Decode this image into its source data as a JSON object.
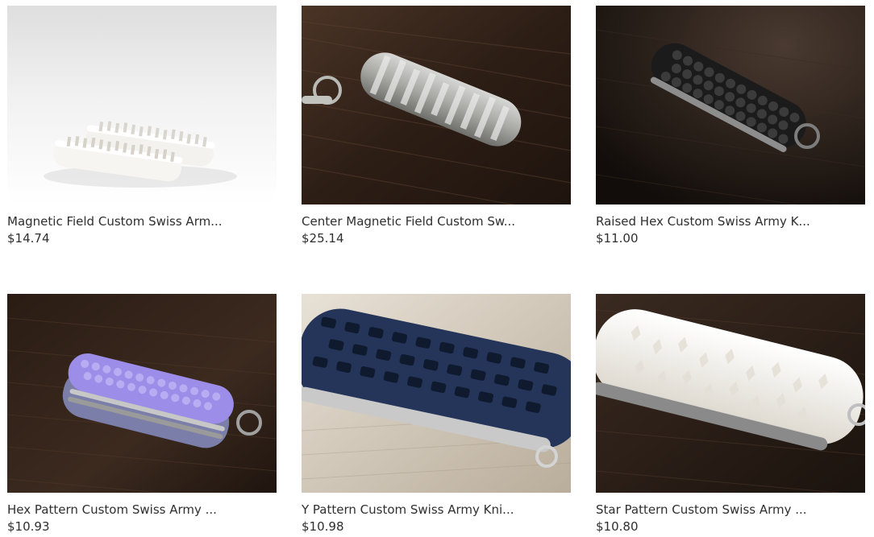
{
  "products": [
    {
      "title": "Magnetic Field Custom Swiss Arm...",
      "price": "$14.74"
    },
    {
      "title": "Center Magnetic Field Custom Sw...",
      "price": "$25.14"
    },
    {
      "title": "Raised Hex Custom Swiss Army K...",
      "price": "$11.00"
    },
    {
      "title": "Hex Pattern Custom Swiss Army ...",
      "price": "$10.93"
    },
    {
      "title": "Y Pattern Custom Swiss Army Kni...",
      "price": "$10.98"
    },
    {
      "title": "Star Pattern Custom Swiss Army ...",
      "price": "$10.80"
    }
  ],
  "colors": {
    "wood_dark": "#2a1d15",
    "text": "#2f2f2f",
    "studio_bg": "#e9e9e9"
  }
}
